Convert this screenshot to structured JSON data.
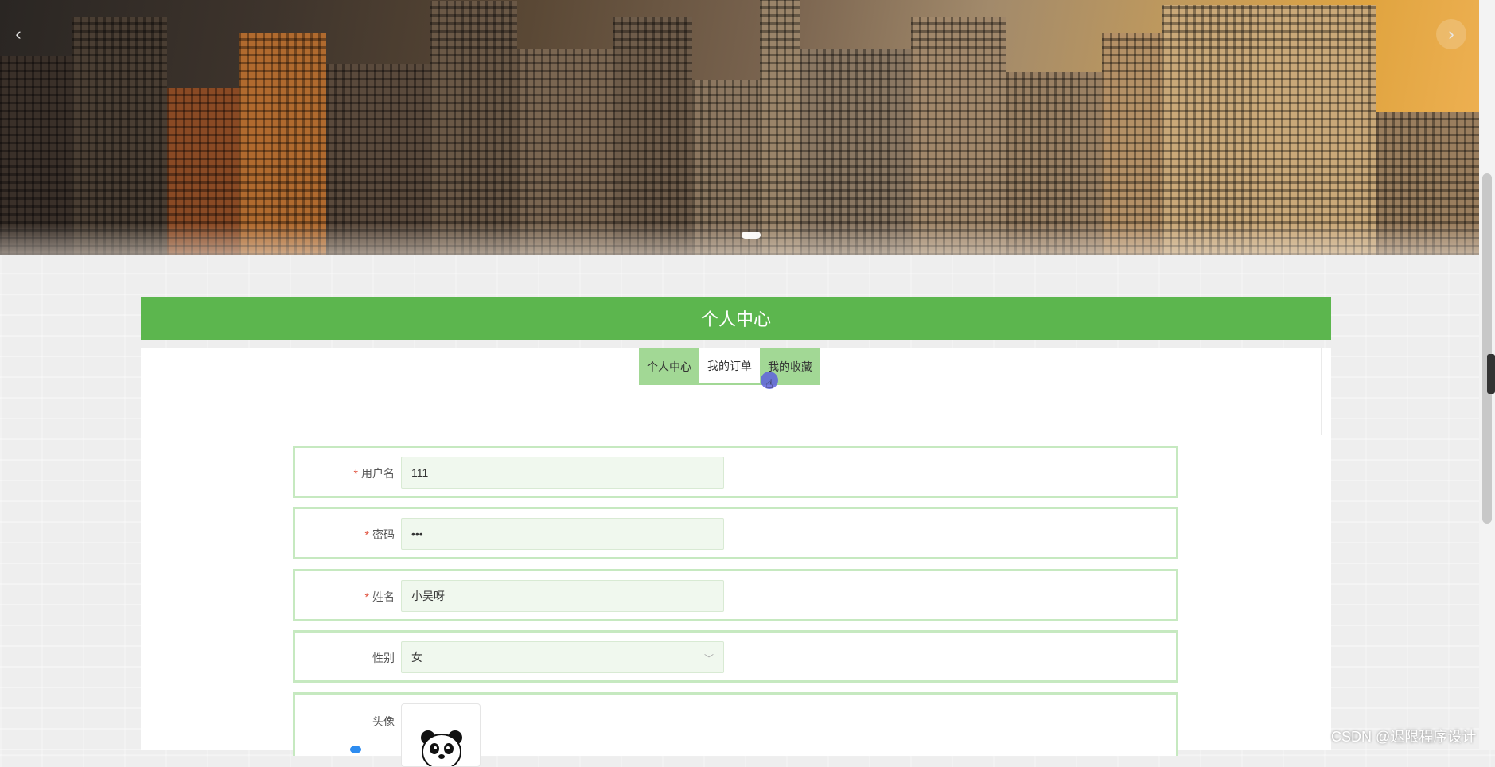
{
  "carousel": {
    "prev_icon": "chevron-left-icon",
    "next_icon": "chevron-right-icon",
    "prev_glyph": "‹",
    "next_glyph": "›",
    "active_slide": 1
  },
  "header": {
    "title": "个人中心"
  },
  "tabs": [
    {
      "label": "个人中心",
      "active": false
    },
    {
      "label": "我的订单",
      "active": true
    },
    {
      "label": "我的收藏",
      "active": false
    }
  ],
  "form": {
    "username": {
      "label": "用户名",
      "required": true,
      "value": "111"
    },
    "password": {
      "label": "密码",
      "required": true,
      "value": "•••"
    },
    "name": {
      "label": "姓名",
      "required": true,
      "value": "小吴呀"
    },
    "gender": {
      "label": "性别",
      "required": false,
      "value": "女"
    },
    "avatar": {
      "label": "头像",
      "required": false,
      "icon": "panda-avatar-icon"
    }
  },
  "required_mark": "*",
  "colors": {
    "accent": "#5cb64e",
    "tab_bg": "#a2d895",
    "field_bg": "#f0f8ee",
    "row_border": "#c6e9c0"
  },
  "watermark": "CSDN @迟限程序设计"
}
